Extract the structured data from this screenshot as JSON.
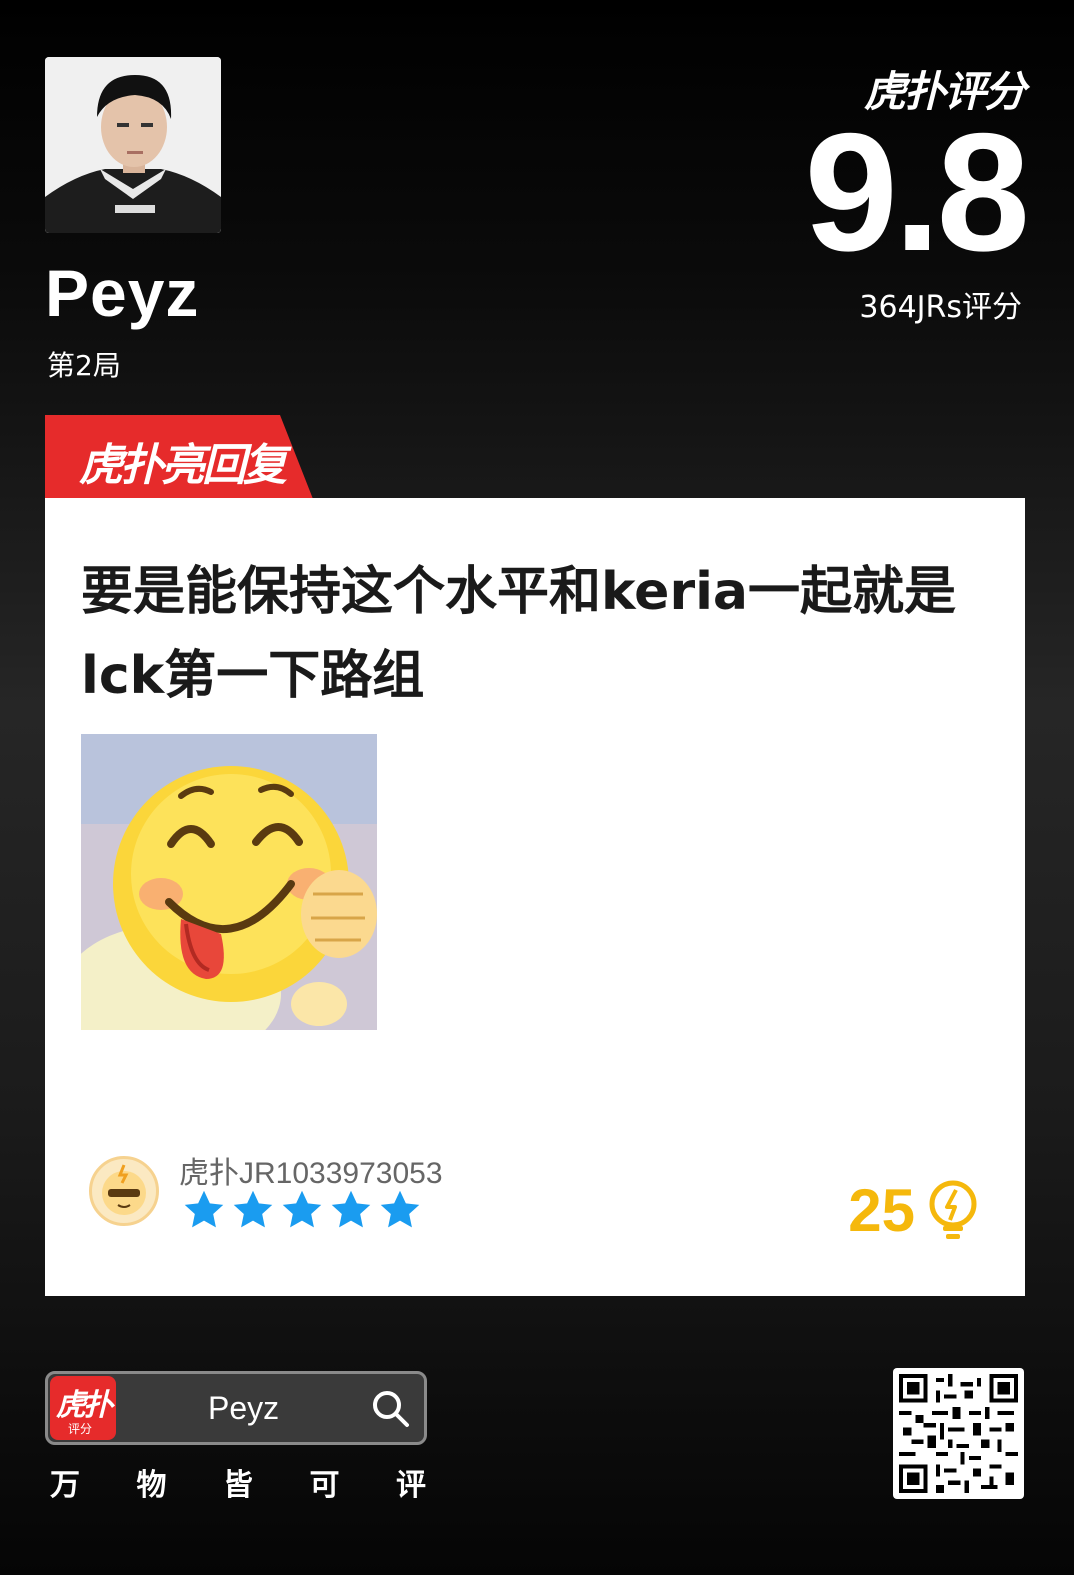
{
  "player": {
    "name": "Peyz",
    "game": "第2局"
  },
  "brand": {
    "logo_text": "虎扑评分",
    "score": "9.8",
    "rating_count": "364JRs评分"
  },
  "badge": {
    "label": "虎扑亮回复"
  },
  "reply": {
    "text": "要是能保持这个水平和keria一起就是lck第一下路组",
    "username": "虎扑JR1033973053",
    "stars": 5,
    "likes": "25"
  },
  "footer": {
    "app_icon_main": "虎扑",
    "app_icon_sub": "评分",
    "search_text": "Peyz",
    "slogan": [
      "万",
      "物",
      "皆",
      "可",
      "评"
    ]
  },
  "colors": {
    "accent_red": "#e62b2b",
    "star_blue": "#1a9cf0",
    "like_gold": "#f5b80c"
  }
}
